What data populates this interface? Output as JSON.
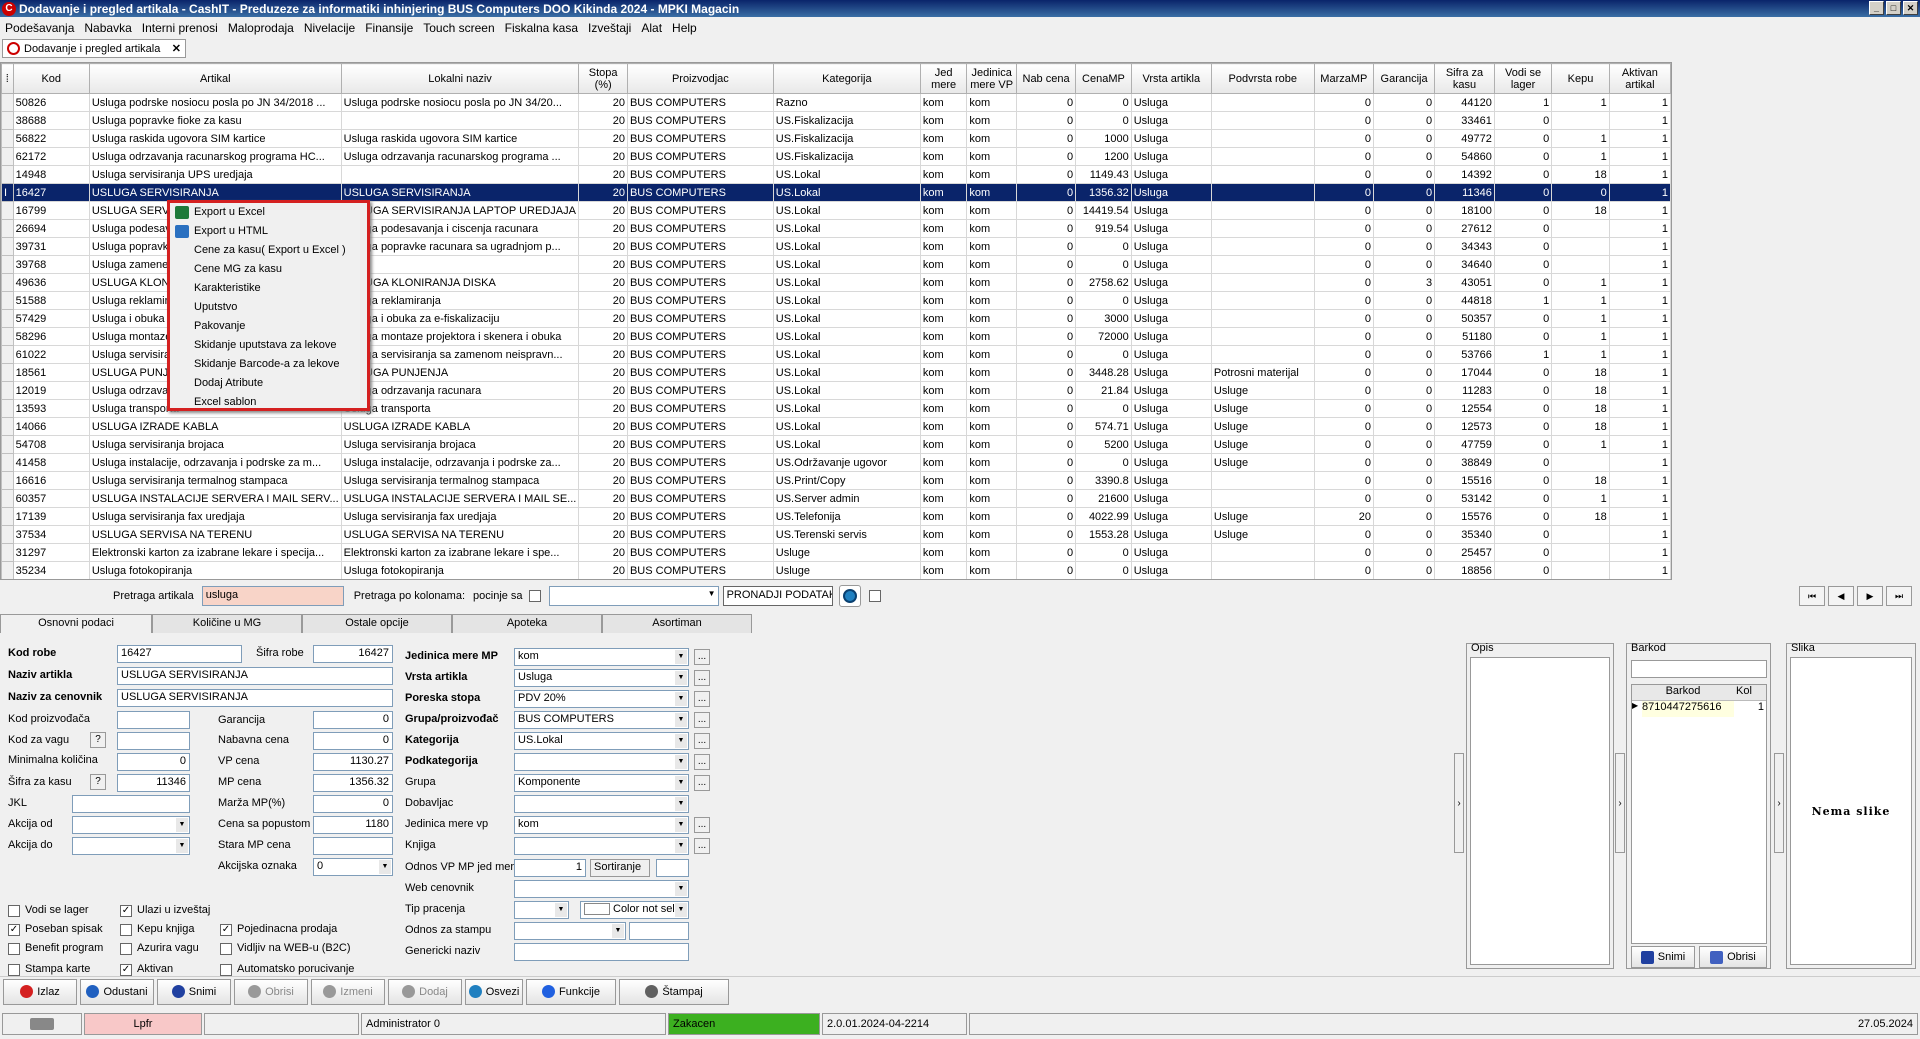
{
  "window": {
    "title": "Dodavanje i pregled artikala - CashIT - Preduzeze za informatiki inhinjering BUS Computers DOO Kikinda 2024 - MPKI Magacin"
  },
  "menu": [
    "Podešavanja",
    "Nabavka",
    "Interni prenosi",
    "Maloprodaja",
    "Nivelacije",
    "Finansije",
    "Touch screen",
    "Fiskalna kasa",
    "Izveštaji",
    "Alat",
    "Help"
  ],
  "doc_tab": {
    "label": "Dodavanje i pregled artikala",
    "close": "✕"
  },
  "grid": {
    "columns": [
      "Kod",
      "Artikal",
      "Lokalni naziv",
      "Stopa (%)",
      "Proizvodjac",
      "Kategorija",
      "Jed mere",
      "Jedinica mere VP",
      "Nab cena",
      "CenaMP",
      "Vrsta artikla",
      "Podvrsta robe",
      "MarzaMP",
      "Garancija",
      "Sifra za kasu",
      "Vodi se lager",
      "Kepu",
      "Aktivan artikal"
    ],
    "rows": [
      [
        "50826",
        "Usluga podrske nosiocu posla po JN 34/2018 ...",
        "Usluga podrske nosiocu posla po JN 34/20...",
        "20",
        "BUS COMPUTERS",
        "Razno",
        "kom",
        "kom",
        "0",
        "0",
        "Usluga",
        "",
        "0",
        "0",
        "44120",
        "1",
        "1",
        "1"
      ],
      [
        "38688",
        "Usluga popravke fioke za kasu",
        "",
        "20",
        "BUS COMPUTERS",
        "US.Fiskalizacija",
        "kom",
        "kom",
        "0",
        "0",
        "Usluga",
        "",
        "0",
        "0",
        "33461",
        "0",
        "",
        "1"
      ],
      [
        "56822",
        "Usluga raskida ugovora SIM kartice",
        "Usluga raskida ugovora SIM kartice",
        "20",
        "BUS COMPUTERS",
        "US.Fiskalizacija",
        "kom",
        "kom",
        "0",
        "1000",
        "Usluga",
        "",
        "0",
        "0",
        "49772",
        "0",
        "1",
        "1"
      ],
      [
        "62172",
        "Usluga odrzavanja racunarskog programa HC...",
        "Usluga odrzavanja racunarskog programa ...",
        "20",
        "BUS COMPUTERS",
        "US.Fiskalizacija",
        "kom",
        "kom",
        "0",
        "1200",
        "Usluga",
        "",
        "0",
        "0",
        "54860",
        "0",
        "1",
        "1"
      ],
      [
        "14948",
        "Usluga servisiranja UPS uredjaja",
        "",
        "20",
        "BUS COMPUTERS",
        "US.Lokal",
        "kom",
        "kom",
        "0",
        "1149.43",
        "Usluga",
        "",
        "0",
        "0",
        "14392",
        "0",
        "18",
        "1"
      ],
      [
        "16427",
        "USLUGA SERVISIRANJA",
        "USLUGA SERVISIRANJA",
        "20",
        "BUS COMPUTERS",
        "US.Lokal",
        "kom",
        "kom",
        "0",
        "1356.32",
        "Usluga",
        "",
        "0",
        "0",
        "11346",
        "0",
        "0",
        "1"
      ],
      [
        "16799",
        "USLUGA SERVISIRANJA LAPTOP UREDJAJA",
        "USLUGA SERVISIRANJA LAPTOP UREDJAJA",
        "20",
        "BUS COMPUTERS",
        "US.Lokal",
        "kom",
        "kom",
        "0",
        "14419.54",
        "Usluga",
        "",
        "0",
        "0",
        "18100",
        "0",
        "18",
        "1"
      ],
      [
        "26694",
        "Usluga podesavanja i ciscenja racunara",
        "Usluga podesavanja i ciscenja racunara",
        "20",
        "BUS COMPUTERS",
        "US.Lokal",
        "kom",
        "kom",
        "0",
        "919.54",
        "Usluga",
        "",
        "0",
        "0",
        "27612",
        "0",
        "",
        "1"
      ],
      [
        "39731",
        "Usluga popravke racunara sa ugradnjom p...",
        "Usluga popravke racunara sa ugradnjom p...",
        "20",
        "BUS COMPUTERS",
        "US.Lokal",
        "kom",
        "kom",
        "0",
        "0",
        "Usluga",
        "",
        "0",
        "0",
        "34343",
        "0",
        "",
        "1"
      ],
      [
        "39768",
        "Usluga zamene",
        "",
        "20",
        "BUS COMPUTERS",
        "US.Lokal",
        "kom",
        "kom",
        "0",
        "0",
        "Usluga",
        "",
        "0",
        "0",
        "34640",
        "0",
        "",
        "1"
      ],
      [
        "49636",
        "USLUGA KLONIRANJA DISKA",
        "USLUGA KLONIRANJA DISKA",
        "20",
        "BUS COMPUTERS",
        "US.Lokal",
        "kom",
        "kom",
        "0",
        "2758.62",
        "Usluga",
        "",
        "0",
        "3",
        "43051",
        "0",
        "1",
        "1"
      ],
      [
        "51588",
        "Usluga reklamiranja",
        "Usluga reklamiranja",
        "20",
        "BUS COMPUTERS",
        "US.Lokal",
        "kom",
        "kom",
        "0",
        "0",
        "Usluga",
        "",
        "0",
        "0",
        "44818",
        "1",
        "1",
        "1"
      ],
      [
        "57429",
        "Usluga i obuka za e-fiskalizaciju",
        "Usluga i obuka za e-fiskalizaciju",
        "20",
        "BUS COMPUTERS",
        "US.Lokal",
        "kom",
        "kom",
        "0",
        "3000",
        "Usluga",
        "",
        "0",
        "0",
        "50357",
        "0",
        "1",
        "1"
      ],
      [
        "58296",
        "Usluga montaze projektora i skenera i obuka",
        "Usluga montaze projektora i skenera i obuka",
        "20",
        "BUS COMPUTERS",
        "US.Lokal",
        "kom",
        "kom",
        "0",
        "72000",
        "Usluga",
        "",
        "0",
        "0",
        "51180",
        "0",
        "1",
        "1"
      ],
      [
        "61022",
        "Usluga servisiranja sa zamenom neispravn...",
        "Usluga servisiranja sa zamenom neispravn...",
        "20",
        "BUS COMPUTERS",
        "US.Lokal",
        "kom",
        "kom",
        "0",
        "0",
        "Usluga",
        "",
        "0",
        "0",
        "53766",
        "1",
        "1",
        "1"
      ],
      [
        "18561",
        "USLUGA PUNJENJA",
        "USLUGA PUNJENJA",
        "20",
        "BUS COMPUTERS",
        "US.Lokal",
        "kom",
        "kom",
        "0",
        "3448.28",
        "Usluga",
        "Potrosni materijal",
        "0",
        "0",
        "17044",
        "0",
        "18",
        "1"
      ],
      [
        "12019",
        "Usluga odrzavanja racunara",
        "Usluga odrzavanja racunara",
        "20",
        "BUS COMPUTERS",
        "US.Lokal",
        "kom",
        "kom",
        "0",
        "21.84",
        "Usluga",
        "Usluge",
        "0",
        "0",
        "11283",
        "0",
        "18",
        "1"
      ],
      [
        "13593",
        "Usluga transporta",
        "Usluga transporta",
        "20",
        "BUS COMPUTERS",
        "US.Lokal",
        "kom",
        "kom",
        "0",
        "0",
        "Usluga",
        "Usluge",
        "0",
        "0",
        "12554",
        "0",
        "18",
        "1"
      ],
      [
        "14066",
        "USLUGA IZRADE KABLA",
        "USLUGA IZRADE KABLA",
        "20",
        "BUS COMPUTERS",
        "US.Lokal",
        "kom",
        "kom",
        "0",
        "574.71",
        "Usluga",
        "Usluge",
        "0",
        "0",
        "12573",
        "0",
        "18",
        "1"
      ],
      [
        "54708",
        "Usluga servisiranja brojaca",
        "Usluga servisiranja brojaca",
        "20",
        "BUS COMPUTERS",
        "US.Lokal",
        "kom",
        "kom",
        "0",
        "5200",
        "Usluga",
        "Usluge",
        "0",
        "0",
        "47759",
        "0",
        "1",
        "1"
      ],
      [
        "41458",
        "Usluga instalacije, odrzavanja i podrske za m...",
        "Usluga instalacije, odrzavanja i podrske za...",
        "20",
        "BUS COMPUTERS",
        "US.Održavanje ugovor",
        "kom",
        "kom",
        "0",
        "0",
        "Usluga",
        "Usluge",
        "0",
        "0",
        "38849",
        "0",
        "",
        "1"
      ],
      [
        "16616",
        "Usluga servisiranja termalnog stampaca",
        "Usluga servisiranja termalnog stampaca",
        "20",
        "BUS COMPUTERS",
        "US.Print/Copy",
        "kom",
        "kom",
        "0",
        "3390.8",
        "Usluga",
        "",
        "0",
        "0",
        "15516",
        "0",
        "18",
        "1"
      ],
      [
        "60357",
        "USLUGA INSTALACIJE SERVERA I MAIL SERV...",
        "USLUGA INSTALACIJE SERVERA I MAIL SE...",
        "20",
        "BUS COMPUTERS",
        "US.Server admin",
        "kom",
        "kom",
        "0",
        "21600",
        "Usluga",
        "",
        "0",
        "0",
        "53142",
        "0",
        "1",
        "1"
      ],
      [
        "17139",
        "Usluga servisiranja fax uredjaja",
        "Usluga servisiranja fax uredjaja",
        "20",
        "BUS COMPUTERS",
        "US.Telefonija",
        "kom",
        "kom",
        "0",
        "4022.99",
        "Usluga",
        "Usluge",
        "20",
        "0",
        "15576",
        "0",
        "18",
        "1"
      ],
      [
        "37534",
        "USLUGA SERVISA NA TERENU",
        "USLUGA SERVISA NA TERENU",
        "20",
        "BUS COMPUTERS",
        "US.Terenski servis",
        "kom",
        "kom",
        "0",
        "1553.28",
        "Usluga",
        "Usluge",
        "0",
        "0",
        "35340",
        "0",
        "",
        "1"
      ],
      [
        "31297",
        "Elektronski karton za izabrane lekare i specija...",
        "Elektronski karton za izabrane lekare i spe...",
        "20",
        "BUS COMPUTERS",
        "Usluge",
        "kom",
        "kom",
        "0",
        "0",
        "Usluga",
        "",
        "0",
        "0",
        "25457",
        "0",
        "",
        "1"
      ],
      [
        "35234",
        "Usluga fotokopiranja",
        "Usluga fotokopiranja",
        "20",
        "BUS COMPUTERS",
        "Usluge",
        "kom",
        "kom",
        "0",
        "0",
        "Usluga",
        "",
        "0",
        "0",
        "18856",
        "0",
        "",
        "1"
      ]
    ],
    "selected_index": 5
  },
  "context_menu": [
    "Export u Excel",
    "Export u HTML",
    "Cene za kasu( Export u Excel )",
    "Cene MG za kasu",
    "Karakteristike",
    "Uputstvo",
    "Pakovanje",
    "Skidanje uputstava za lekove",
    "Skidanje Barcode-a za lekove",
    "Dodaj Atribute",
    "Excel sablon"
  ],
  "search": {
    "label": "Pretraga artikala",
    "value": "usluga",
    "by_cols_label": "Pretraga po kolonama:",
    "starts_label": "pocinje sa",
    "find_label": "PRONADJI PODATAK"
  },
  "nav": [
    "⏮",
    "◀",
    "▶",
    "⏭"
  ],
  "tabs": [
    "Osnovni podaci",
    "Količine u MG",
    "Ostale opcije",
    "Apoteka",
    "Asortiman"
  ],
  "form": {
    "kod_robe_l": "Kod robe",
    "kod_robe": "16427",
    "sifra_robe_l": "Šifra robe",
    "sifra_robe": "16427",
    "naziv_l": "Naziv artikla",
    "naziv": "USLUGA SERVISIRANJA",
    "cenovnik_l": "Naziv za cenovnik",
    "cenovnik": "USLUGA SERVISIRANJA",
    "kod_proiz_l": "Kod proizvođača",
    "kod_vaga_l": "Kod za vagu",
    "min_kol_l": "Minimalna količina",
    "min_kol": "0",
    "sifra_kasa_l": "Šifra za kasu",
    "sifra_kasa": "11346",
    "jkl_l": "JKL",
    "akcija_od_l": "Akcija od",
    "akcija_do_l": "Akcija do",
    "garancija_l": "Garancija",
    "garancija": "0",
    "nab_l": "Nabavna cena",
    "nab": "0",
    "vp_l": "VP cena",
    "vp": "1130.27",
    "mp_l": "MP cena",
    "mp": "1356.32",
    "marza_l": "Marža MP(%)",
    "marza": "0",
    "popust_l": "Cena sa popustom",
    "popust": "1180",
    "stara_l": "Stara MP cena",
    "akc_oz_l": "Akcijska oznaka",
    "akc_oz": "0",
    "jm_mp_l": "Jedinica mere MP",
    "jm_mp": "kom",
    "vrsta_l": "Vrsta artikla",
    "vrsta": "Usluga",
    "stopa_l": "Poreska stopa",
    "stopa": "PDV 20%",
    "grupa_l": "Grupa/proizvođač",
    "grupa": "BUS COMPUTERS",
    "kat_l": "Kategorija",
    "kat": "US.Lokal",
    "podkat_l": "Podkategorija",
    "grp_l": "Grupa",
    "grp": "Komponente",
    "dob_l": "Dobavljac",
    "jm_vp_l": "Jedinica mere vp",
    "jm_vp": "kom",
    "knjiga_l": "Knjiga",
    "odnos_l": "Odnos VP MP jed mere",
    "odnos": "1",
    "sort": "Sortiranje",
    "web_l": "Web cenovnik",
    "tip_l": "Tip pracenja",
    "color": "Color not sel",
    "stampa_l": "Odnos za stampu",
    "gen_l": "Genericki naziv",
    "q": "?",
    "dots": "..."
  },
  "checks": [
    {
      "label": "Vodi se lager",
      "checked": false
    },
    {
      "label": "Ulazi u izveštaj",
      "checked": true
    },
    {
      "label": "Poseban spisak",
      "checked": true
    },
    {
      "label": "Kepu knjiga",
      "checked": false
    },
    {
      "label": "Pojedinacna prodaja",
      "checked": true
    },
    {
      "label": "Benefit program",
      "checked": false
    },
    {
      "label": "Azurira vagu",
      "checked": false
    },
    {
      "label": "Vidljiv na WEB-u (B2C)",
      "checked": false
    },
    {
      "label": "Stampa karte",
      "checked": false
    },
    {
      "label": "Aktivan",
      "checked": true
    },
    {
      "label": "Automatsko porucivanje",
      "checked": false
    }
  ],
  "opis": {
    "title": "Opis"
  },
  "barkod": {
    "title": "Barkod",
    "col1": "Barkod",
    "col2": "Kol",
    "code": "8710447275616",
    "kol": "1",
    "save": "Snimi",
    "del": "Obrisi"
  },
  "slika": {
    "title": "Slika",
    "empty": "Nema slike"
  },
  "buttons": [
    {
      "label": "Izlaz",
      "color": "#d42020",
      "dis": false
    },
    {
      "label": "Odustani",
      "color": "#2060c0",
      "dis": false
    },
    {
      "label": "Snimi",
      "color": "#2040a0",
      "dis": false
    },
    {
      "label": "Obrisi",
      "color": "#999999",
      "dis": true
    },
    {
      "label": "Izmeni",
      "color": "#999999",
      "dis": true
    },
    {
      "label": "Dodaj",
      "color": "#999999",
      "dis": true
    },
    {
      "label": "Osvezi",
      "color": "#2080c0",
      "dis": false
    },
    {
      "label": "Funkcije",
      "color": "#2060e0",
      "dis": false
    },
    {
      "label": "Štampaj",
      "color": "#606060",
      "dis": false
    }
  ],
  "status": {
    "user_code": "Lpfr",
    "user": "Administrator 0",
    "state": "Zakacen",
    "version": "2.0.01.2024-04-2214",
    "date": "27.05.2024"
  }
}
